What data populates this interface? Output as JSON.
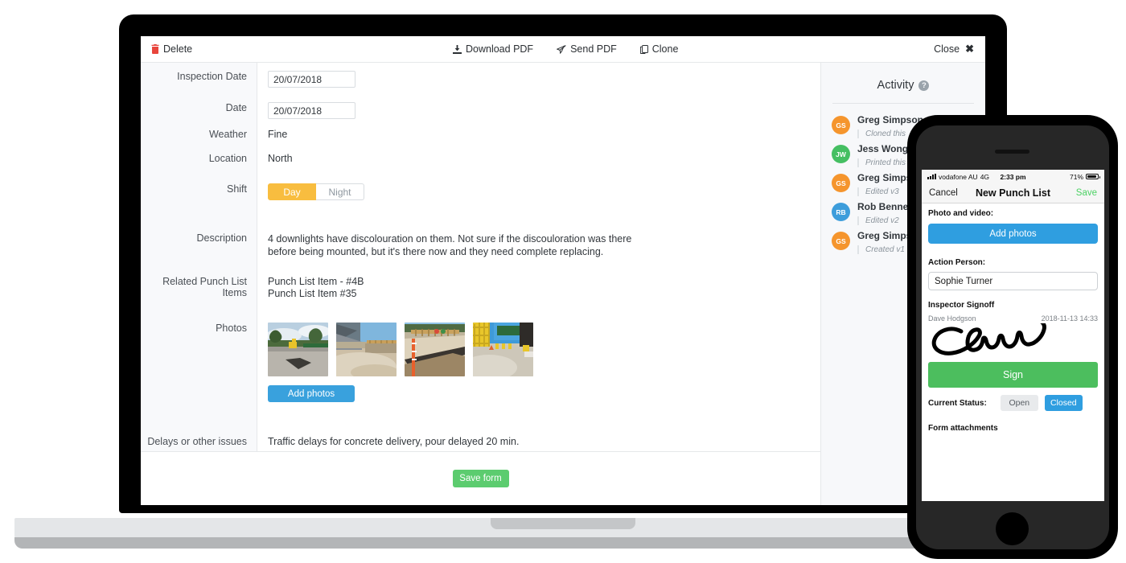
{
  "toolbar": {
    "delete_label": "Delete",
    "download_label": "Download PDF",
    "send_label": "Send PDF",
    "clone_label": "Clone",
    "close_label": "Close",
    "close_icon_glyph": "✖"
  },
  "form": {
    "rows": [
      {
        "label": "Inspection Date",
        "value": "20/07/2018",
        "type": "date"
      },
      {
        "label": "Date",
        "value": "20/07/2018",
        "type": "date"
      },
      {
        "label": "Weather",
        "value": "Fine",
        "type": "text"
      },
      {
        "label": "Location",
        "value": "North",
        "type": "text"
      },
      {
        "label": "Shift",
        "type": "toggle",
        "options": [
          "Day",
          "Night"
        ],
        "selected": "Day"
      },
      {
        "label": "Description",
        "type": "paragraph",
        "value": "4 downlights have discolouration on them. Not sure if the discouloration was there before being mounted, but it's there now and they need complete replacing."
      },
      {
        "label": "Related Punch List Items",
        "type": "list",
        "items": [
          "Punch List Item - #4B",
          "Punch List Item #35"
        ]
      },
      {
        "label": "Photos",
        "type": "photos",
        "add_label": "Add photos",
        "count": 4
      },
      {
        "label": "Delays or other issues",
        "type": "text",
        "value": "Traffic delays for concrete delivery, pour delayed 20 min."
      }
    ],
    "save_label": "Save form"
  },
  "activity": {
    "title": "Activity",
    "help_glyph": "?",
    "items": [
      {
        "initials": "GS",
        "name": "Greg Simpson",
        "action": "Cloned this",
        "color": "#f5952d"
      },
      {
        "initials": "JW",
        "name": "Jess Wong",
        "action": "Printed this",
        "color": "#45bf62"
      },
      {
        "initials": "GS",
        "name": "Greg Simpson",
        "action": "Edited v3",
        "color": "#f5952d"
      },
      {
        "initials": "RB",
        "name": "Rob Bennett",
        "action": "Edited v2",
        "color": "#3d9ddb"
      },
      {
        "initials": "GS",
        "name": "Greg Simpson",
        "action": "Created v1",
        "color": "#f5952d"
      }
    ]
  },
  "phone": {
    "status": {
      "carrier": "vodafone AU",
      "network": "4G",
      "time": "2:33 pm",
      "battery": "71%"
    },
    "nav": {
      "cancel": "Cancel",
      "title": "New Punch List",
      "save": "Save"
    },
    "photo_label": "Photo and video:",
    "add_photos_label": "Add photos",
    "action_person_label": "Action Person:",
    "action_person_value": "Sophie Turner",
    "signoff_label": "Inspector Signoff",
    "signoff_name": "Dave Hodgson",
    "signoff_time": "2018-11-13 14:33",
    "sign_label": "Sign",
    "status_label": "Current Status:",
    "status_options": [
      "Open",
      "Closed"
    ],
    "status_selected": "Closed",
    "attachments_label": "Form attachments"
  },
  "colors": {
    "accent_blue": "#39a1dd",
    "accent_green": "#5ccc6f",
    "accent_yellow": "#f8bd3f",
    "danger_red": "#e8453c"
  }
}
